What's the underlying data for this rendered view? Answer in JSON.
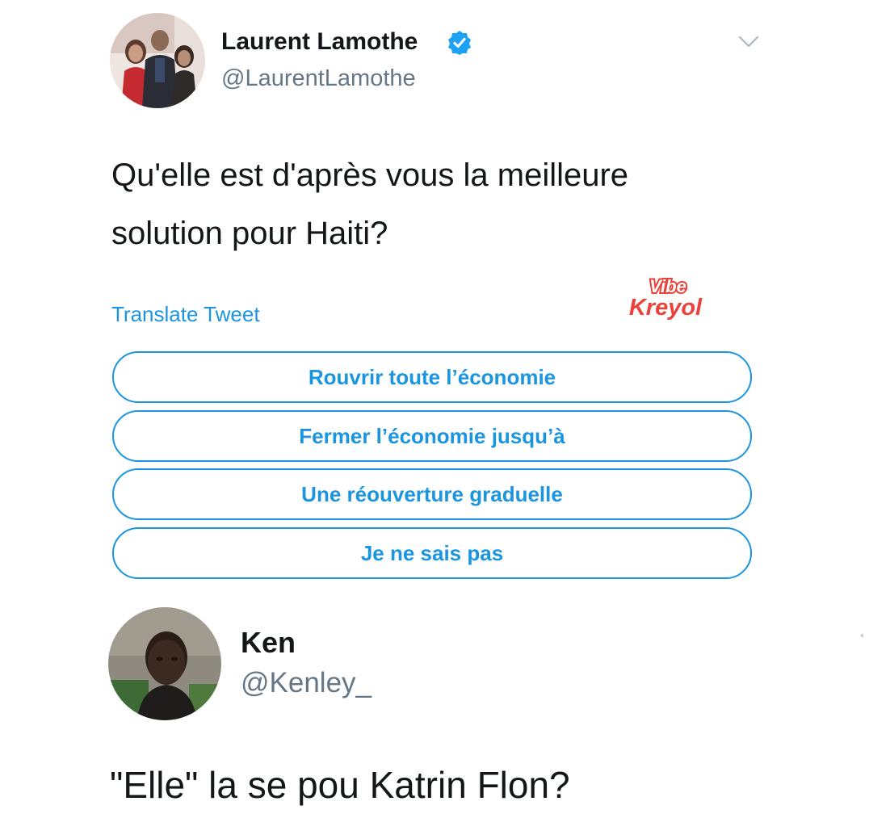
{
  "tweet": {
    "author": {
      "name": "Laurent Lamothe",
      "handle": "@LaurentLamothe",
      "verified": true
    },
    "text_lines": [
      "Qu'elle est d'après vous la meilleure",
      "solution pour Haiti?"
    ],
    "translate_label": "Translate Tweet",
    "poll_options": [
      "Rouvrir toute l’économie",
      "Fermer l’économie jusqu’à",
      "Une réouverture graduelle",
      "Je ne sais pas"
    ]
  },
  "watermark": {
    "line1": "Vibe",
    "line2": "Kreyol"
  },
  "reply": {
    "author": {
      "name": "Ken",
      "handle": "@Kenley_"
    },
    "text": "\"Elle\" la se pou Katrin Flon?"
  },
  "colors": {
    "accent": "#1b95e0",
    "text_primary": "#14171a",
    "text_secondary": "#657786",
    "watermark_red": "#e8423a"
  },
  "icons": {
    "verified": "verified-badge-icon",
    "menu": "chevron-down-icon"
  }
}
